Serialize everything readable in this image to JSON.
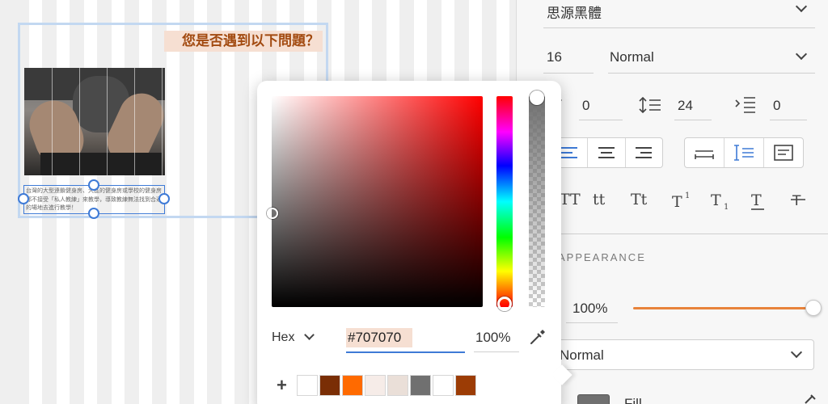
{
  "canvas": {
    "heading": "您是否遇到以下問題？",
    "body_text": "台灣的大型連鎖健身房、大區的健身房或學校的健身房都不接受「私人教練」來教學，導致教練無法找到合適的場地去進行教學！"
  },
  "panel": {
    "font_family": "思源黑體",
    "font_size": "16",
    "font_weight": "Normal",
    "letter_spacing": "0",
    "line_height": "24",
    "paragraph_spacing": "0",
    "case_labels": [
      "TT",
      "tt",
      "Tt"
    ],
    "section_label": "APPEARANCE",
    "opacity_value": "100%",
    "opacity": 1.0,
    "blend_mode": "Normal",
    "fill_label": "Fill"
  },
  "picker": {
    "format": "Hex",
    "hex_value": "#707070",
    "alpha": "100%",
    "swatches": [
      "#ffffff",
      "#7a2e05",
      "#ff6a00",
      "#f6ece8",
      "#eadfd8",
      "#707070",
      "#ffffff",
      "#9c3c05"
    ]
  },
  "colors": {
    "accent": "#3e7ad6",
    "heading_text": "#a24a10",
    "heading_bg": "#f6dfd2",
    "slider": "#e8833a"
  }
}
